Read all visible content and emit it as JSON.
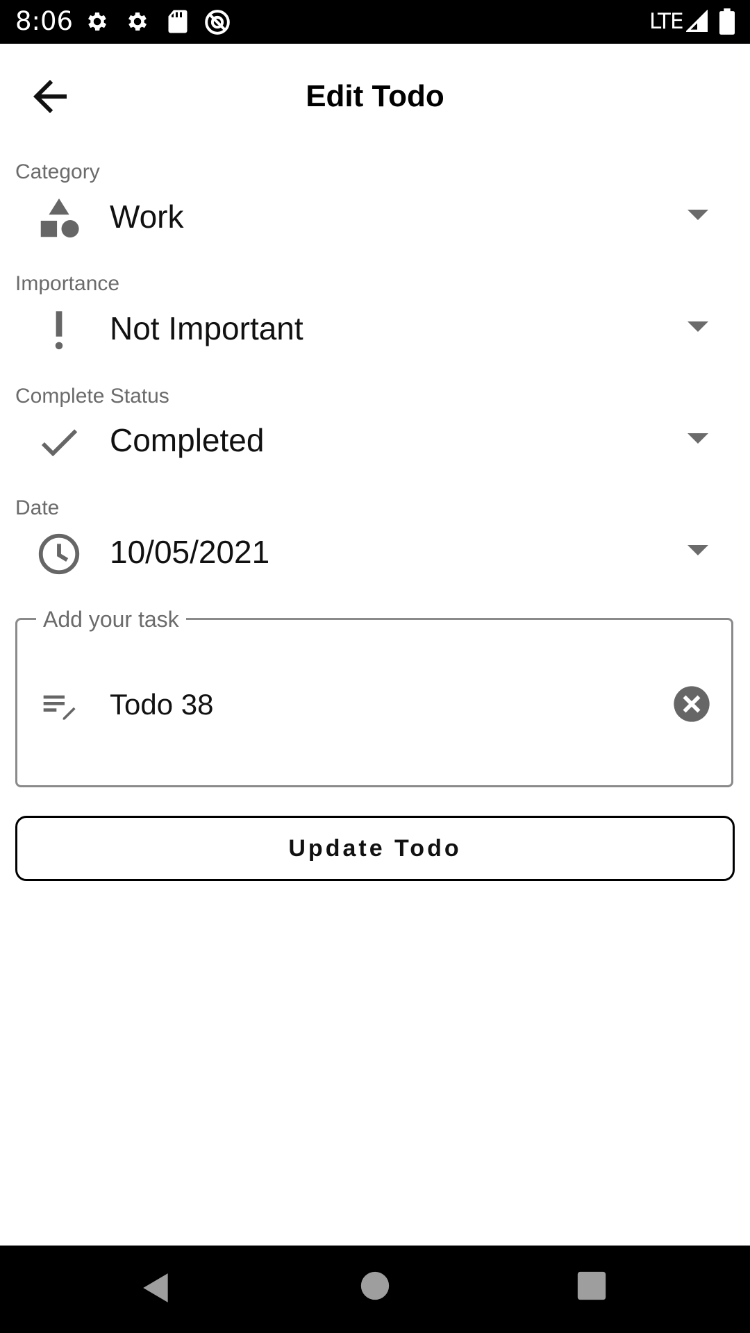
{
  "status_bar": {
    "time": "8:06",
    "network": "LTE",
    "icons": [
      "settings-icon",
      "settings-icon",
      "sd-card-icon",
      "do-not-disturb-icon",
      "signal-icon",
      "battery-icon"
    ]
  },
  "app_bar": {
    "title": "Edit Todo",
    "back_icon": "arrow-back-icon"
  },
  "fields": {
    "category": {
      "label": "Category",
      "value": "Work",
      "icon": "category-shapes-icon"
    },
    "importance": {
      "label": "Importance",
      "value": "Not Important",
      "icon": "priority-exclamation-icon"
    },
    "status": {
      "label": "Complete Status",
      "value": "Completed",
      "icon": "check-icon"
    },
    "date": {
      "label": "Date",
      "value": "10/05/2021",
      "icon": "clock-icon"
    }
  },
  "task": {
    "label": "Add your task",
    "value": "Todo 38",
    "icon": "edit-note-icon",
    "clear_icon": "clear-circle-icon"
  },
  "actions": {
    "update_label": "Update Todo"
  },
  "nav_bar": {
    "icons": [
      "nav-back-icon",
      "nav-home-icon",
      "nav-recents-icon"
    ]
  },
  "colors": {
    "text_primary": "#111111",
    "text_secondary": "#6b6b6b",
    "icon_gray": "#666666",
    "border": "#8a8a8a",
    "bars": "#000000"
  }
}
